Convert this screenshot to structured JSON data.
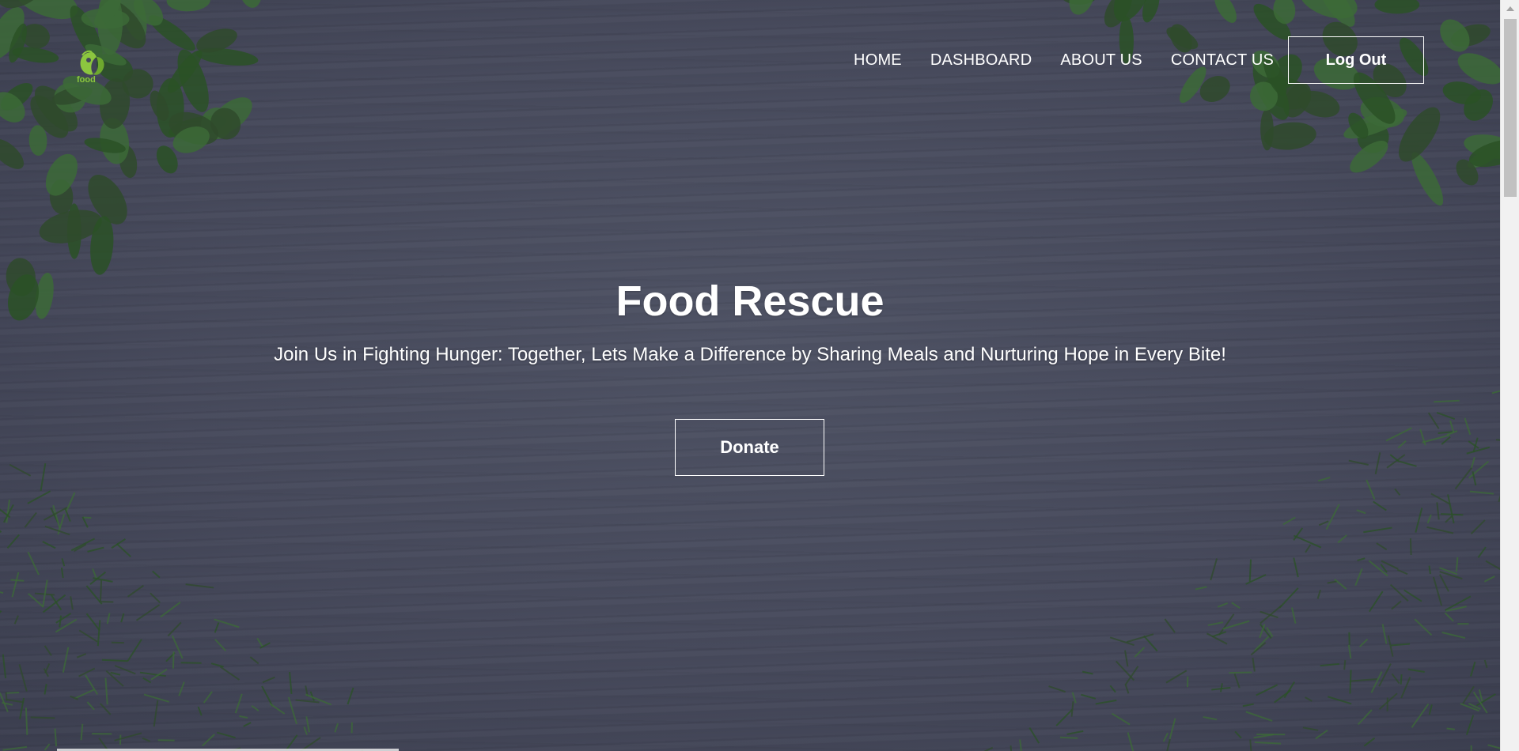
{
  "brand": {
    "logo_text": "food",
    "logo_color": "#8cc63f"
  },
  "nav": {
    "items": [
      {
        "label": "HOME"
      },
      {
        "label": "DASHBOARD"
      },
      {
        "label": "ABOUT US"
      },
      {
        "label": "CONTACT US"
      }
    ],
    "logout_label": "Log Out"
  },
  "hero": {
    "title": "Food Rescue",
    "subtitle": "Join Us in Fighting Hunger: Together, Lets Make a Difference by Sharing Meals and Nurturing Hope in Every Bite!",
    "donate_label": "Donate",
    "background_color": "#45485a",
    "foliage_colors": [
      "#2f4a2c",
      "#3c6a37",
      "#2a5126"
    ]
  }
}
